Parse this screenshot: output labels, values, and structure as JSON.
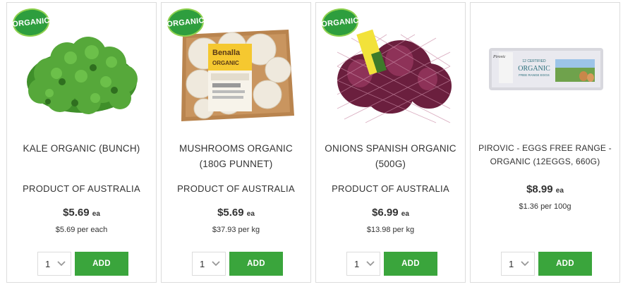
{
  "products": [
    {
      "badge": "ORGANIC",
      "name": "KALE ORGANIC (BUNCH)",
      "origin": "PRODUCT OF AUSTRALIA",
      "price": "$5.69",
      "price_unit": "ea",
      "unit_price": "$5.69 per each",
      "qty": "1",
      "add_label": "ADD",
      "image": "kale-image"
    },
    {
      "badge": "ORGANIC",
      "name": "MUSHROOMS ORGANIC (180G PUNNET)",
      "origin": "PRODUCT OF AUSTRALIA",
      "price": "$5.69",
      "price_unit": "ea",
      "unit_price": "$37.93 per kg",
      "qty": "1",
      "add_label": "ADD",
      "image": "mushrooms-image"
    },
    {
      "badge": "ORGANIC",
      "name": "ONIONS SPANISH ORGANIC (500G)",
      "origin": "PRODUCT OF AUSTRALIA",
      "price": "$6.99",
      "price_unit": "ea",
      "unit_price": "$13.98 per kg",
      "qty": "1",
      "add_label": "ADD",
      "image": "onions-image"
    },
    {
      "name": "PIROVIC - EGGS FREE RANGE - ORGANIC (12EGGS, 660G)",
      "price": "$8.99",
      "price_unit": "ea",
      "unit_price": "$1.36 per 100g",
      "qty": "1",
      "add_label": "ADD",
      "image": "eggs-carton-image",
      "pack_text": {
        "brand": "Pirovic",
        "line1": "12 CERTIFIED",
        "line2": "ORGANIC",
        "line3": "FREE RANGE EGGS"
      }
    }
  ],
  "colors": {
    "add_button": "#3aa53c",
    "badge": "#2e9e3e",
    "border": "#dcdcdc"
  }
}
